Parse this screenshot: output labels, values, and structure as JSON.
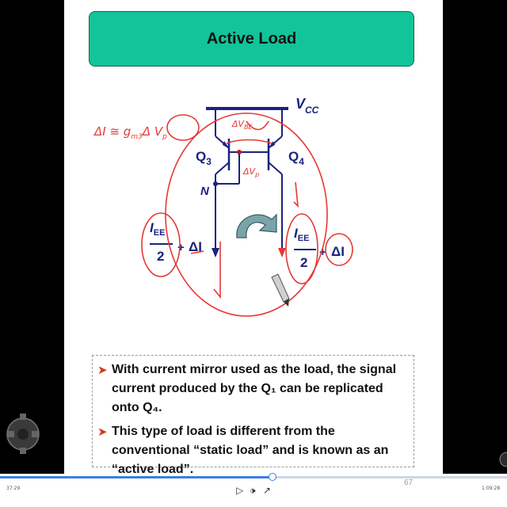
{
  "slide": {
    "title": "Active Load",
    "page_number": "67",
    "bullets": [
      "With current mirror used as the load, the signal current produced by the Q₁ can be replicated onto Q₄.",
      "This type of load is different from the conventional “static load” and is known as an “active load”."
    ]
  },
  "circuit": {
    "vcc_label": "V",
    "vcc_sub": "CC",
    "q3_label": "Q",
    "q3_sub": "3",
    "q4_label": "Q",
    "q4_sub": "4",
    "node_label": "N",
    "left_current": {
      "numerator": "I",
      "numerator_sub": "EE",
      "denominator": "2",
      "delta": "ΔI"
    },
    "right_current": {
      "numerator": "I",
      "numerator_sub": "EE",
      "denominator": "2",
      "delta": "ΔI"
    },
    "annotation_left": "ΔI ≅ g",
    "annotation_left_sub": "m3",
    "annotation_left_tail": "Δ V",
    "annotation_left_tail_sub": "p",
    "annotation_vp": "ΔV",
    "annotation_vp_sub": "p",
    "annotation_top": "ΔV",
    "annotation_top_sub": "BE",
    "colors": {
      "ink": "#1a237e",
      "pen": "#e53935",
      "arrow_fill": "#7aa4aa"
    }
  },
  "player": {
    "current_time": "37:29",
    "total_time": "1:09:28",
    "progress": 0.538,
    "play_icon": "play-icon",
    "volume_icon": "volume-icon",
    "fullscreen_icon": "fullscreen-icon"
  }
}
